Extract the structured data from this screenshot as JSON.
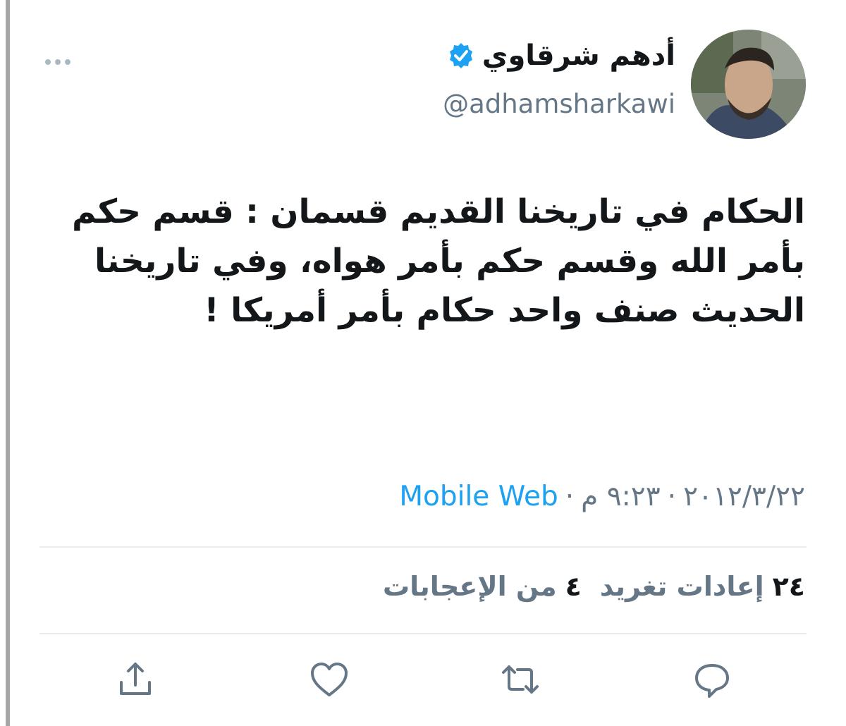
{
  "author": {
    "display_name": "أدهم شرقاوي",
    "handle": "@adhamsharkawi",
    "verified": true
  },
  "tweet": {
    "text": "الحكام في تاريخنا القديم قسمان : قسم حكم بأمر الله وقسم حكم بأمر هواه، وفي تاريخنا الحديث صنف واحد حكام بأمر أمريكا !",
    "date": "٢٠١٢/٣/٢٢",
    "time": "٩:٢٣ م",
    "separator": "·",
    "source": "Mobile Web"
  },
  "stats": {
    "retweets_count": "٢٤",
    "retweets_label": "إعادات تغريد",
    "likes_count": "٤",
    "likes_label": "من الإعجابات"
  },
  "icons": {
    "more": "more-icon",
    "verified": "verified-badge-icon",
    "reply": "reply-icon",
    "retweet": "retweet-icon",
    "like": "heart-icon",
    "share": "share-icon"
  },
  "colors": {
    "accent": "#1da1f2",
    "text_primary": "#14171a",
    "text_secondary": "#657786",
    "divider": "#e6ecf0"
  }
}
